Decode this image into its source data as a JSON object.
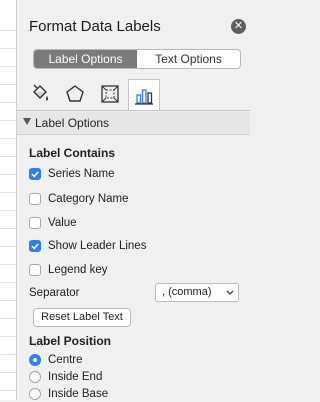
{
  "pane": {
    "title": "Format Data Labels",
    "close_icon": "close-icon"
  },
  "options_tabs": [
    {
      "label": "Label Options",
      "active": true
    },
    {
      "label": "Text Options",
      "active": false
    }
  ],
  "icon_tabs": [
    {
      "icon": "fill-line-icon",
      "active": false
    },
    {
      "icon": "effects-pentagon-icon",
      "active": false
    },
    {
      "icon": "size-properties-icon",
      "active": false
    },
    {
      "icon": "label-options-chart-icon",
      "active": true
    }
  ],
  "section": {
    "label": "Label Options",
    "expanded": true
  },
  "label_contains": {
    "title": "Label Contains",
    "items": [
      {
        "label": "Series Name",
        "checked": true
      },
      {
        "label": "Category Name",
        "checked": false
      },
      {
        "label": "Value",
        "checked": false
      },
      {
        "label": "Show Leader Lines",
        "checked": true
      },
      {
        "label": "Legend key",
        "checked": false
      }
    ]
  },
  "separator": {
    "label": "Separator",
    "value": ", (comma)"
  },
  "reset_button": "Reset Label Text",
  "label_position": {
    "title": "Label Position",
    "options": [
      {
        "label": "Centre",
        "selected": true
      },
      {
        "label": "Inside End",
        "selected": false
      },
      {
        "label": "Inside Base",
        "selected": false
      }
    ]
  },
  "colors": {
    "accent": "#2d7ff9",
    "active_segment": "#7a7a7a",
    "pane_bg": "#f0f0f0"
  }
}
